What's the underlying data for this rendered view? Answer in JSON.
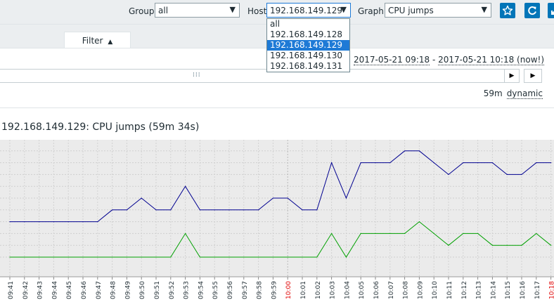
{
  "header": {
    "group_label": "Group",
    "group_value": "all",
    "host_label": "Host",
    "host_value": "192.168.149.129",
    "graph_label": "Graph",
    "graph_value": "CPU jumps",
    "buttons": [
      "star-icon",
      "refresh-icon",
      "fullscreen-icon"
    ]
  },
  "host_dropdown": {
    "options": [
      "all",
      "192.168.149.128",
      "192.168.149.129",
      "192.168.149.130",
      "192.168.149.131"
    ],
    "selected_index": 2
  },
  "filter": {
    "tab_label": "Filter",
    "tab_icon": "triangle-up-icon",
    "time_from": "2017-05-21 09:18",
    "time_sep": " - ",
    "time_to": "2017-05-21 10:18 (now!)",
    "period": "59m",
    "mode": "dynamic"
  },
  "graph": {
    "title": "192.168.149.129: CPU jumps (59m 34s)"
  },
  "colors": {
    "accent": "#0275b8",
    "series_blue": "#000090",
    "series_green": "#00a000",
    "now_tick": "#e00000",
    "plot_bg": "#ebebeb"
  },
  "chart_data": {
    "type": "line",
    "title": "192.168.149.129: CPU jumps (59m 34s)",
    "x": [
      "09:41",
      "09:42",
      "09:43",
      "09:44",
      "09:45",
      "09:46",
      "09:47",
      "09:48",
      "09:49",
      "09:50",
      "09:51",
      "09:52",
      "09:53",
      "09:54",
      "09:55",
      "09:56",
      "09:57",
      "09:58",
      "09:59",
      "10:00",
      "10:01",
      "10:02",
      "10:03",
      "10:04",
      "10:05",
      "10:06",
      "10:07",
      "10:08",
      "10:09",
      "10:10",
      "10:11",
      "10:12",
      "10:13",
      "10:14",
      "10:15",
      "10:16",
      "10:17",
      "10:18"
    ],
    "highlight_x": [
      "10:00",
      "10:18"
    ],
    "series": [
      {
        "color": "#000090",
        "values": [
          3,
          3,
          3,
          3,
          3,
          3,
          3,
          4,
          4,
          5,
          4,
          4,
          6,
          4,
          4,
          4,
          4,
          4,
          5,
          5,
          4,
          4,
          8,
          5,
          8,
          8,
          8,
          9,
          9,
          8,
          7,
          8,
          8,
          8,
          7,
          7,
          8,
          8
        ]
      },
      {
        "color": "#00a000",
        "values": [
          0,
          0,
          0,
          0,
          0,
          0,
          0,
          0,
          0,
          0,
          0,
          0,
          2,
          0,
          0,
          0,
          0,
          0,
          0,
          0,
          0,
          0,
          2,
          0,
          2,
          2,
          2,
          2,
          3,
          2,
          1,
          2,
          2,
          1,
          1,
          1,
          2,
          1
        ]
      }
    ],
    "ylim": [
      0,
      10
    ],
    "grid": true,
    "y_tick_labels_visible": false
  }
}
